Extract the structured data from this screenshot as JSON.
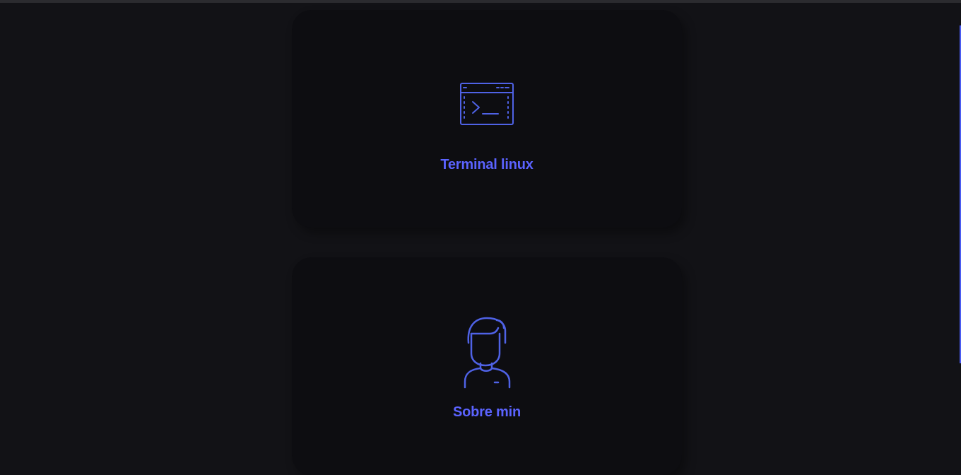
{
  "cards": [
    {
      "title": "Terminal linux",
      "icon": "terminal-icon"
    },
    {
      "title": "Sobre min",
      "icon": "user-avatar-icon"
    }
  ],
  "colors": {
    "accent": "#5b63ff",
    "icon_stroke": "#4f62e6",
    "background": "#121216",
    "card_background": "#0d0d11"
  }
}
